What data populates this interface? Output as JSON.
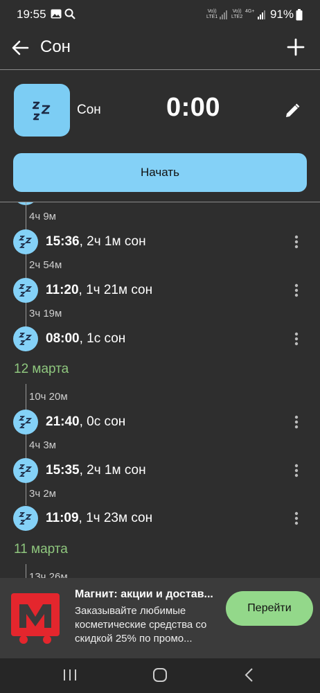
{
  "status_bar": {
    "time": "19:55",
    "battery": "91%",
    "sim1": "LTE1",
    "sim2": "LTE2",
    "volte": "Vo))",
    "net": "4G+"
  },
  "app_bar": {
    "title": "Сон"
  },
  "header": {
    "activity_name": "Сон",
    "timer": "0:00",
    "start_label": "Начать"
  },
  "timeline": {
    "gaps": [
      "4ч 9м",
      "2ч 54м",
      "3ч 19м",
      "10ч 20м",
      "4ч 3м",
      "3ч 2м",
      "13ч 26м"
    ],
    "entries": [
      {
        "time": "15:36",
        "rest": ", 2ч 1м сон"
      },
      {
        "time": "11:20",
        "rest": ", 1ч 21м сон"
      },
      {
        "time": "08:00",
        "rest": ", 1с сон"
      },
      {
        "time": "21:40",
        "rest": ", 0с сон"
      },
      {
        "time": "15:35",
        "rest": ", 2ч 1м сон"
      },
      {
        "time": "11:09",
        "rest": ", 1ч 23м сон"
      }
    ],
    "dates": [
      "12 марта",
      "11 марта"
    ]
  },
  "ad": {
    "title": "Магнит: акции и достав...",
    "body": "Заказывайте любимые косметические средства со скидкой 25% по промо...",
    "button": "Перейти"
  },
  "colors": {
    "accent": "#84d1f7",
    "date": "#8fc77e",
    "background": "#2e2e2e",
    "ad_button": "#93d88a",
    "brand_red": "#e4262d"
  }
}
